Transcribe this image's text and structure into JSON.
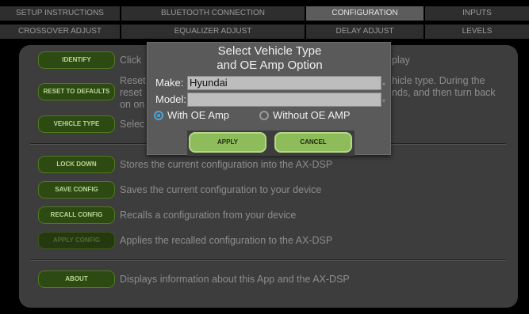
{
  "tabs_row1": [
    {
      "label": "SETUP INSTRUCTIONS",
      "active": false
    },
    {
      "label": "BLUETOOTH CONNECTION",
      "active": false
    },
    {
      "label": "CONFIGURATION",
      "active": true
    },
    {
      "label": "INPUTS",
      "active": false
    }
  ],
  "tabs_row2": [
    {
      "label": "CROSSOVER ADJUST"
    },
    {
      "label": "EQUALIZER ADJUST"
    },
    {
      "label": "DELAY ADJUST"
    },
    {
      "label": "LEVELS"
    }
  ],
  "rows": {
    "identify": {
      "button": "IDENTIFY",
      "desc": "Click"
    },
    "identify_tail": "play",
    "reset": {
      "button": "RESET TO DEFAULTS",
      "desc_line1": "Reset",
      "desc_line2": "reset",
      "desc_line3": "on on"
    },
    "reset_tail_line1": "hicle type. During the",
    "reset_tail_line2": "nds, and then turn back",
    "vehicle": {
      "button": "VEHICLE TYPE",
      "desc": "Selec"
    },
    "lockdown": {
      "button": "LOCK DOWN",
      "desc": "Stores the current configuration into the AX-DSP"
    },
    "save": {
      "button": "SAVE CONFIG",
      "desc": "Saves the current configuration to your device"
    },
    "recall": {
      "button": "RECALL CONFIG",
      "desc": "Recalls a configuration from your device"
    },
    "apply": {
      "button": "APPLY CONFIG",
      "desc": "Applies the recalled configuration to the AX-DSP"
    },
    "about": {
      "button": "ABOUT",
      "desc": "Displays information about this App and the AX-DSP"
    }
  },
  "modal": {
    "title_line1": "Select Vehicle Type",
    "title_line2": "and OE Amp Option",
    "make_label": "Make:",
    "make_value": "Hyundai",
    "model_label": "Model:",
    "model_value": "",
    "radio_with": "With OE Amp",
    "radio_without": "Without OE AMP",
    "selected_option": "With OE Amp",
    "apply_label": "APPLY",
    "cancel_label": "CANCEL"
  },
  "colors": {
    "accent_green": "#8ebc5a",
    "radio_accent": "#4aa6d6",
    "active_tab": "#5c5c5c"
  }
}
